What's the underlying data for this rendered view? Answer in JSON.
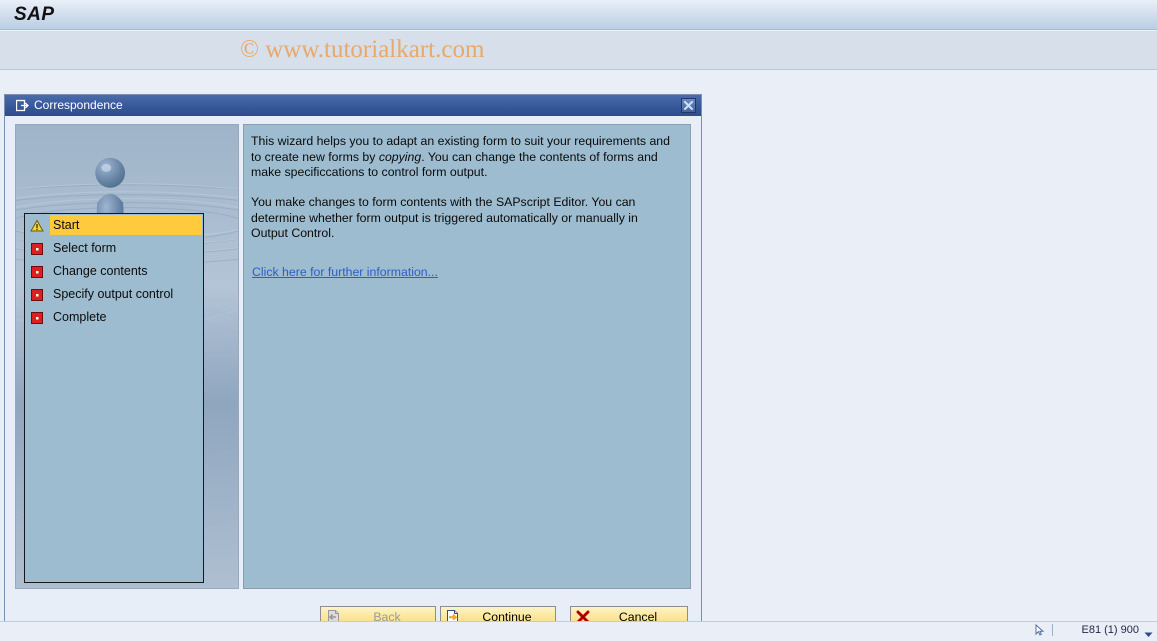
{
  "header": {
    "logo": "SAP"
  },
  "watermark": {
    "text": "© www.tutorialkart.com"
  },
  "dialog": {
    "title": "Correspondence",
    "title_icon": "window-icon",
    "close_icon": "close-icon",
    "illustration": "water-droplet-ripple-image",
    "steps": [
      {
        "label": "Start",
        "icon": "warning-triangle-icon",
        "state": "active"
      },
      {
        "label": "Select form",
        "icon": "red-square-icon",
        "state": "pending"
      },
      {
        "label": "Change contents",
        "icon": "red-square-icon",
        "state": "pending"
      },
      {
        "label": "Specify output control",
        "icon": "red-square-icon",
        "state": "pending"
      },
      {
        "label": "Complete",
        "icon": "red-square-icon",
        "state": "pending"
      }
    ],
    "content": {
      "paragraph1_a": "This wizard helps you to adapt an existing form to suit your requirements and to create new forms by ",
      "paragraph1_em": "copying",
      "paragraph1_b": ". You can change the contents of forms and make specificcations to control form output.",
      "paragraph2": "You make changes to form contents with the SAPscript Editor. You can determine whether form output is triggered automatically or manually in Output Control.",
      "link": "Click here for further information..."
    },
    "buttons": {
      "back": {
        "label": "Back",
        "icon": "back-arrow-page-icon",
        "disabled": true
      },
      "continue": {
        "label": "Continue",
        "icon": "forward-arrow-page-icon",
        "disabled": false
      },
      "cancel": {
        "label": "Cancel",
        "icon": "red-x-icon",
        "disabled": false
      }
    }
  },
  "statusbar": {
    "system": "E81 (1) 900",
    "cursor_icon": "cursor-icon",
    "caret_icon": "chevron-down-icon"
  },
  "colors": {
    "title_bar": "#37589a",
    "content_panel": "#9dbccf",
    "highlight": "#ffcb3d",
    "link": "#2a5fc4",
    "watermark": "#e8a96a",
    "button": "#fbe79a"
  }
}
